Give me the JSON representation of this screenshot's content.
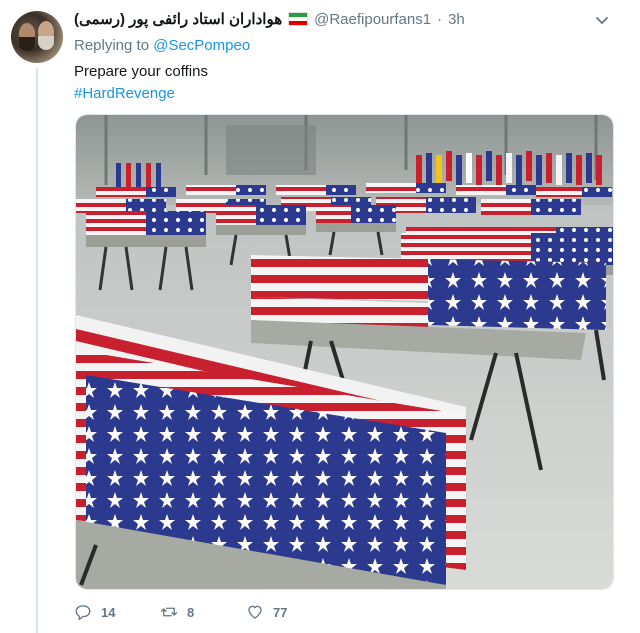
{
  "tweet": {
    "display_name": "هواداران استاد رائفی پور (رسمی)",
    "handle": "@Raefipourfans1",
    "separator": "·",
    "time": "3h",
    "replying_prefix": "Replying to",
    "replying_to": "@SecPompeo",
    "text_line1": "Prepare your coffins",
    "hashtag": "#HardRevenge"
  },
  "actions": {
    "reply_count": "14",
    "retweet_count": "8",
    "like_count": "77"
  },
  "icons": {
    "flag": "iran-flag-icon",
    "menu": "chevron-down-icon",
    "reply": "reply-icon",
    "retweet": "retweet-icon",
    "like": "heart-icon"
  },
  "colors": {
    "link": "#1b95e0",
    "muted": "#657786",
    "thread_line": "#cfe4f6"
  }
}
